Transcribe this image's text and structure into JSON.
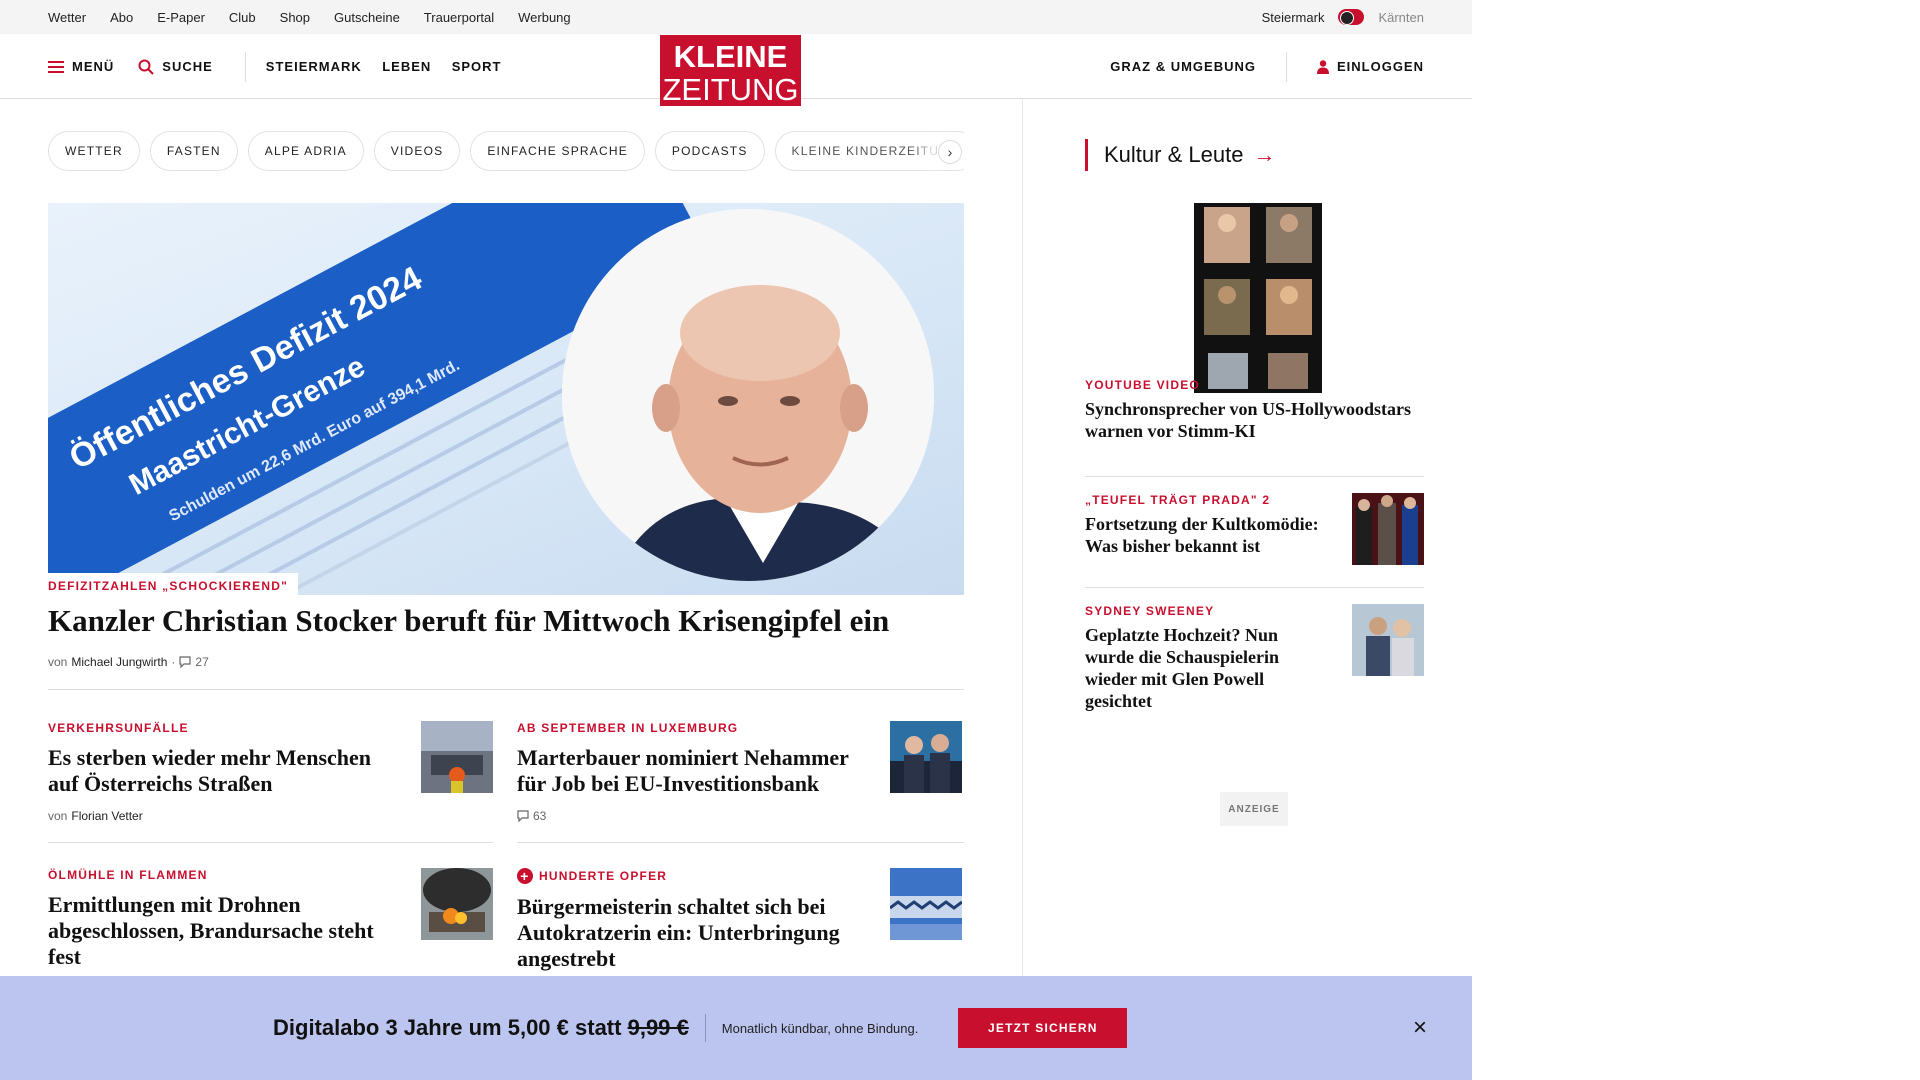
{
  "utility_bar": {
    "links": [
      "Wetter",
      "Abo",
      "E-Paper",
      "Club",
      "Shop",
      "Gutscheine",
      "Trauerportal",
      "Werbung"
    ],
    "region_active": "Steiermark",
    "region_inactive": "Kärnten"
  },
  "header": {
    "menu_label": "MENÜ",
    "search_label": "SUCHE",
    "nav": [
      "STEIERMARK",
      "LEBEN",
      "SPORT"
    ],
    "logo_line1": "KLEINE",
    "logo_line2": "ZEITUNG",
    "local_label": "GRAZ & UMGEBUNG",
    "login_label": "EINLOGGEN"
  },
  "chips": [
    "WETTER",
    "FASTEN",
    "ALPE ADRIA",
    "VIDEOS",
    "EINFACHE SPRACHE",
    "PODCASTS",
    "KLEINE KINDERZEITUNG"
  ],
  "hero": {
    "image_text_1": "Öffentliches Defizit 2024",
    "image_text_2": "Maastricht-Grenze",
    "image_text_3": "Schulden um 22,6 Mrd. Euro auf 394,1 Mrd.",
    "kicker": "DEFIZITZAHLEN „SCHOCKIEREND\"",
    "title": "Kanzler Christian Stocker beruft für Mittwoch Krisengipfel ein",
    "byline_prefix": "von",
    "author": "Michael Jungwirth",
    "comments": "27"
  },
  "articles": [
    {
      "kicker": "VERKEHRSUNFÄLLE",
      "title": "Es sterben wieder mehr Menschen auf Österreichs Straßen",
      "byline_prefix": "von",
      "author": "Florian Vetter"
    },
    {
      "kicker": "AB SEPTEMBER IN LUXEMBURG",
      "title": "Marterbauer nominiert Nehammer für Job bei EU-Investitionsbank",
      "comments": "63"
    },
    {
      "kicker": "ÖLMÜHLE IN FLAMMEN",
      "title": "Ermittlungen mit Drohnen abgeschlossen, Brandursache steht fest"
    },
    {
      "kicker": "HUNDERTE OPFER",
      "title": "Bürgermeisterin schaltet sich bei Autokratzerin ein: Unterbringung angestrebt"
    }
  ],
  "sidebar": {
    "section_title": "Kultur & Leute",
    "items": [
      {
        "kicker": "YOUTUBE VIDEO",
        "title": "Synchronsprecher von US-Hollywoodstars warnen vor Stimm-KI"
      },
      {
        "kicker": "„TEUFEL TRÄGT PRADA\" 2",
        "title": "Fortsetzung der Kultkomödie: Was bisher bekannt ist"
      },
      {
        "kicker": "SYDNEY SWEENEY",
        "title": "Geplatzte Hochzeit? Nun wurde die Schauspielerin wieder mit Glen Powell gesichtet"
      }
    ],
    "ad_label": "ANZEIGE"
  },
  "promo": {
    "text_main": "Digitalabo 3 Jahre um 5,00 € statt",
    "text_old_price": "9,99 €",
    "subtext": "Monatlich kündbar, ohne Bindung.",
    "button_label": "JETZT SICHERN"
  },
  "colors": {
    "brand_red": "#c8102e",
    "promo_bg": "#bcc5ef"
  }
}
